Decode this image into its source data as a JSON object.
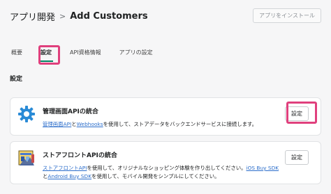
{
  "header": {
    "parent": "アプリ開発",
    "separator": ">",
    "title": "Add Customers",
    "install_button": "アプリをインストール"
  },
  "tabs": [
    {
      "label": "概要"
    },
    {
      "label": "設定"
    },
    {
      "label": "API資格情報"
    },
    {
      "label": "アプリの設定"
    }
  ],
  "section_title": "設定",
  "cards": [
    {
      "title": "管理画面APIの統合",
      "desc_link1": "管理画面API",
      "desc_text1": "と",
      "desc_link2": "Webhooks",
      "desc_text2": "を使用して、ストアデータをバックエンドサービスに接続します。",
      "button": "設定"
    },
    {
      "title": "ストアフロントAPIの統合",
      "desc_link1": "ストアフロントAPI",
      "desc_text1": "を使用して、オリジナルなショッピング体験を作り出してください。",
      "desc_link2": "iOS Buy SDK",
      "desc_text2": "と",
      "desc_link3": "Android Buy SDK",
      "desc_text3": "を使用して、モバイル開発をシンプルにしてください。",
      "button": "設定"
    }
  ],
  "colors": {
    "highlight": "#e0407d",
    "link": "#2c6ecb",
    "tab_underline": "#008060"
  }
}
